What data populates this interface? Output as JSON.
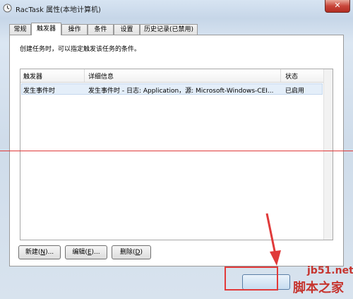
{
  "window": {
    "title": "RacTask 属性(本地计算机)",
    "close_glyph": "✕"
  },
  "tabs": [
    {
      "label": "常规"
    },
    {
      "label": "触发器"
    },
    {
      "label": "操作"
    },
    {
      "label": "条件"
    },
    {
      "label": "设置"
    },
    {
      "label": "历史记录(已禁用)"
    }
  ],
  "active_tab": "触发器",
  "description": "创建任务时，可以指定触发该任务的条件。",
  "table": {
    "headers": [
      "触发器",
      "详细信息",
      "状态"
    ],
    "rows": [
      {
        "trigger": "发生事件时",
        "details": "发生事件时 - 日志: Application，源: Microsoft-Windows-CEI...",
        "status": "已启用"
      }
    ]
  },
  "buttons": {
    "new": {
      "text": "新建(",
      "key": "N",
      "tail": ")..."
    },
    "edit": {
      "text": "编辑(",
      "key": "E",
      "tail": ")..."
    },
    "delete": {
      "text": "删除(",
      "key": "D",
      "tail": ")"
    }
  },
  "watermark": {
    "url": "jb51.net",
    "brand": "脚本之家"
  },
  "colors": {
    "annotation_red": "#e03a3a",
    "selection": "#e4eef9"
  }
}
